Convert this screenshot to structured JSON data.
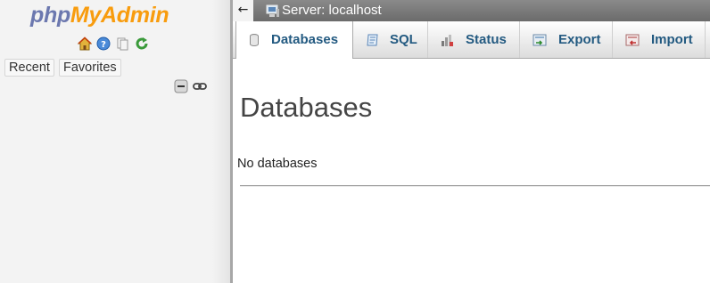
{
  "navigation": {
    "logo": {
      "part1": "php",
      "part2": "MyAdmin"
    },
    "icons": [
      "home-icon",
      "info-icon",
      "documentation-icon",
      "reload-icon"
    ],
    "buttons": {
      "recent": "Recent",
      "favorites": "Favorites"
    },
    "tree_controls": [
      "collapse-all-icon",
      "link-with-main-panel-icon"
    ]
  },
  "server_bar": {
    "back_arrow": "←",
    "label": "Server: localhost"
  },
  "tabs": [
    {
      "label": "Databases",
      "icon": "database-icon",
      "active": true
    },
    {
      "label": "SQL",
      "icon": "sql-icon",
      "active": false
    },
    {
      "label": "Status",
      "icon": "status-icon",
      "active": false
    },
    {
      "label": "Export",
      "icon": "export-icon",
      "active": false
    },
    {
      "label": "Import",
      "icon": "import-icon",
      "active": false
    }
  ],
  "main": {
    "title": "Databases",
    "empty_message": "No databases"
  },
  "colors": {
    "logo_php": "#6c78af",
    "logo_myadmin": "#f89c0e",
    "tab_text": "#235a81",
    "server_bar": "#7a7a7a"
  }
}
